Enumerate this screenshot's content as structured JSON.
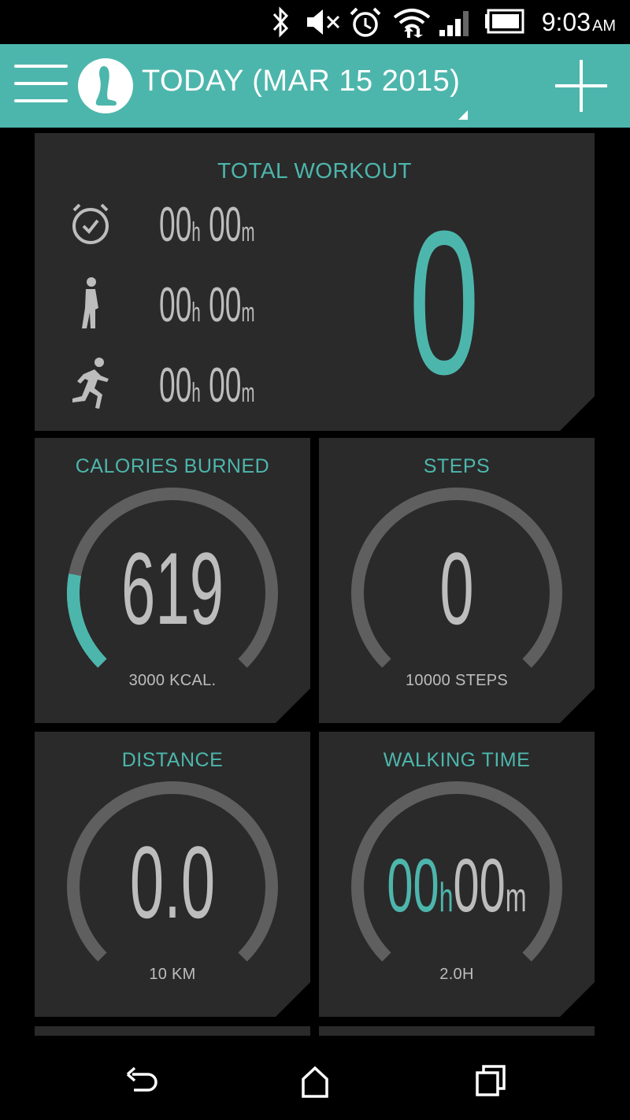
{
  "status_bar": {
    "icons": [
      "bluetooth-icon",
      "volume-muted-icon",
      "alarm-icon",
      "wifi-icon",
      "signal-icon",
      "battery-icon"
    ],
    "time": "9:03",
    "ampm": "AM"
  },
  "app_bar": {
    "title": "TODAY (MAR 15 2015)",
    "menu_icon": "hamburger-menu-icon",
    "add_icon": "plus-icon",
    "color": "#4db6ac"
  },
  "total_workout": {
    "title": "TOTAL WORKOUT",
    "rows": [
      {
        "icon": "stopwatch-icon",
        "hours": "00",
        "hours_unit": "h",
        "minutes": "00",
        "minutes_unit": "m"
      },
      {
        "icon": "walking-icon",
        "hours": "00",
        "hours_unit": "h",
        "minutes": "00",
        "minutes_unit": "m"
      },
      {
        "icon": "running-icon",
        "hours": "00",
        "hours_unit": "h",
        "minutes": "00",
        "minutes_unit": "m"
      }
    ],
    "value": "0"
  },
  "calories": {
    "title": "CALORIES BURNED",
    "value": "619",
    "goal": "3000 KCAL.",
    "progress": 0.206
  },
  "steps": {
    "title": "STEPS",
    "value": "0",
    "goal": "10000 STEPS",
    "progress": 0
  },
  "distance": {
    "title": "DISTANCE",
    "value": "0.0",
    "goal": "10 KM",
    "progress": 0
  },
  "walking_time": {
    "title": "WALKING TIME",
    "hours": "00",
    "hours_unit": "h",
    "minutes": "00",
    "minutes_unit": "m",
    "goal": "2.0H",
    "progress": 0
  },
  "nav_bar": {
    "icons": [
      "back-icon",
      "home-icon",
      "recent-apps-icon"
    ]
  },
  "colors": {
    "accent": "#4db6ac",
    "card": "#2a2a2a",
    "track": "#5f5f5f",
    "text": "#bdbdbd"
  }
}
